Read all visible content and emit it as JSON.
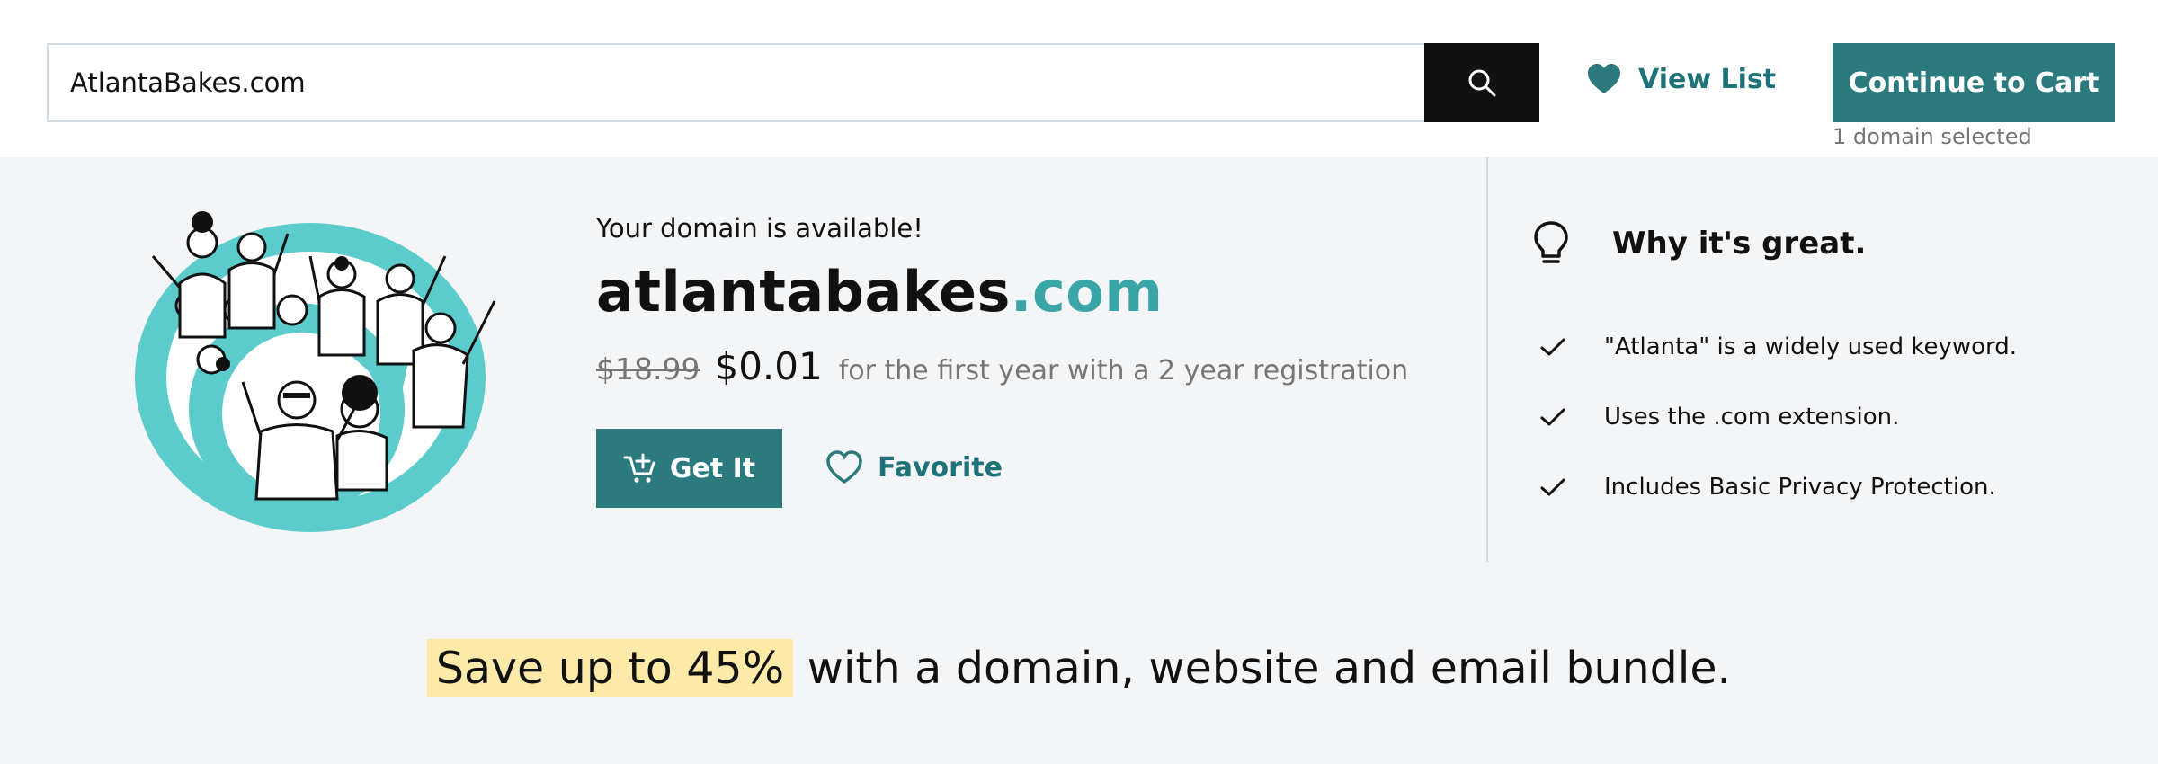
{
  "search": {
    "value": "AtlantaBakes.com"
  },
  "header": {
    "view_list_label": "View List",
    "cart_label": "Continue to Cart",
    "cart_sub": "1 domain selected"
  },
  "result": {
    "status": "Your domain is available!",
    "name": "atlantabakes",
    "tld": ".com",
    "old_price": "$18.99",
    "new_price": "$0.01",
    "price_note": "for the first year with a 2 year registration",
    "get_it_label": "Get It",
    "favorite_label": "Favorite"
  },
  "why": {
    "title": "Why it's great.",
    "reasons": [
      "\"Atlanta\" is a widely used keyword.",
      "Uses the .com extension.",
      "Includes Basic Privacy Protection."
    ]
  },
  "promo": {
    "highlight": "Save up to 45%",
    "rest": " with a domain, website and email bundle."
  },
  "colors": {
    "brand_teal": "#2b7a7e",
    "link_teal": "#1d7377",
    "tld_teal": "#3aa6a8",
    "illustration_teal": "#5ccbcb",
    "highlight_yellow": "#fdeaa8",
    "panel_bg": "#f4f5f7"
  },
  "icons": {
    "search": "search-icon",
    "heart_filled": "heart-filled-icon",
    "cart": "cart-plus-icon",
    "heart_outline": "heart-outline-icon",
    "lightbulb": "lightbulb-icon",
    "check": "check-icon"
  }
}
